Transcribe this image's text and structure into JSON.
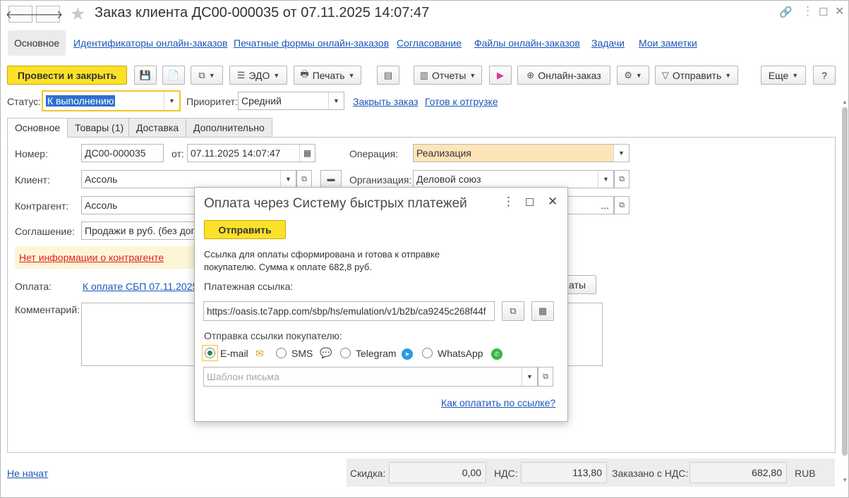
{
  "window": {
    "title": "Заказ клиента ДС00-000035 от 07.11.2025 14:07:47"
  },
  "sections": [
    "Основное",
    "Идентификаторы онлайн-заказов",
    "Печатные формы онлайн-заказов",
    "Согласование",
    "Файлы онлайн-заказов",
    "Задачи",
    "Мои заметки"
  ],
  "toolbar": {
    "post_close": "Провести и закрыть",
    "edo": "ЭДО",
    "print": "Печать",
    "reports": "Отчеты",
    "online_order": "Онлайн-заказ",
    "send": "Отправить",
    "more": "Еще",
    "help": "?"
  },
  "status": {
    "label": "Статус:",
    "value": "К выполнению",
    "priority_label": "Приоритет:",
    "priority_value": "Средний",
    "close_order": "Закрыть заказ",
    "ready_ship": "Готов к отгрузке"
  },
  "tabs": [
    "Основное",
    "Товары (1)",
    "Доставка",
    "Дополнительно"
  ],
  "form": {
    "number_label": "Номер:",
    "number": "ДС00-000035",
    "date_label": "от:",
    "date": "07.11.2025 14:07:47",
    "operation_label": "Операция:",
    "operation": "Реализация",
    "client_label": "Клиент:",
    "client": "Ассоль",
    "org_label": "Организация:",
    "org": "Деловой союз",
    "contractor_label": "Контрагент:",
    "contractor": "Ассоль",
    "agreement_label": "Соглашение:",
    "agreement": "Продажи в руб. (без дог",
    "no_info": "Нет информации о контрагенте",
    "payment_label": "Оплата:",
    "payment_link": "К оплате СБП 07.11.2025",
    "payment_btn": "аты",
    "comment_label": "Комментарий:"
  },
  "footer": {
    "status": "Не начат",
    "discount_label": "Скидка:",
    "discount": "0,00",
    "vat_label": "НДС:",
    "vat": "113,80",
    "total_label": "Заказано с НДС:",
    "total": "682,80",
    "currency": "RUB"
  },
  "modal": {
    "title": "Оплата через Систему быстрых платежей",
    "send": "Отправить",
    "message": "Ссылка для оплаты сформирована и готова к отправке покупателю. Сумма к оплате 682,8 руб.",
    "link_label": "Платежная ссылка:",
    "link": "https://oasis.tc7app.com/sbp/hs/emulation/v1/b2b/ca9245c268f44f",
    "send_label": "Отправка ссылки покупателю:",
    "channels": [
      "E-mail",
      "SMS",
      "Telegram",
      "WhatsApp"
    ],
    "selected_channel": "E-mail",
    "template_placeholder": "Шаблон письма",
    "how_to_pay": "Как оплатить по ссылке?"
  },
  "colors": {
    "accent_yellow": "#fbe12a",
    "link_blue": "#1a56b8",
    "warning_red": "#e01e1e",
    "operation_bg": "#fde5b8"
  }
}
